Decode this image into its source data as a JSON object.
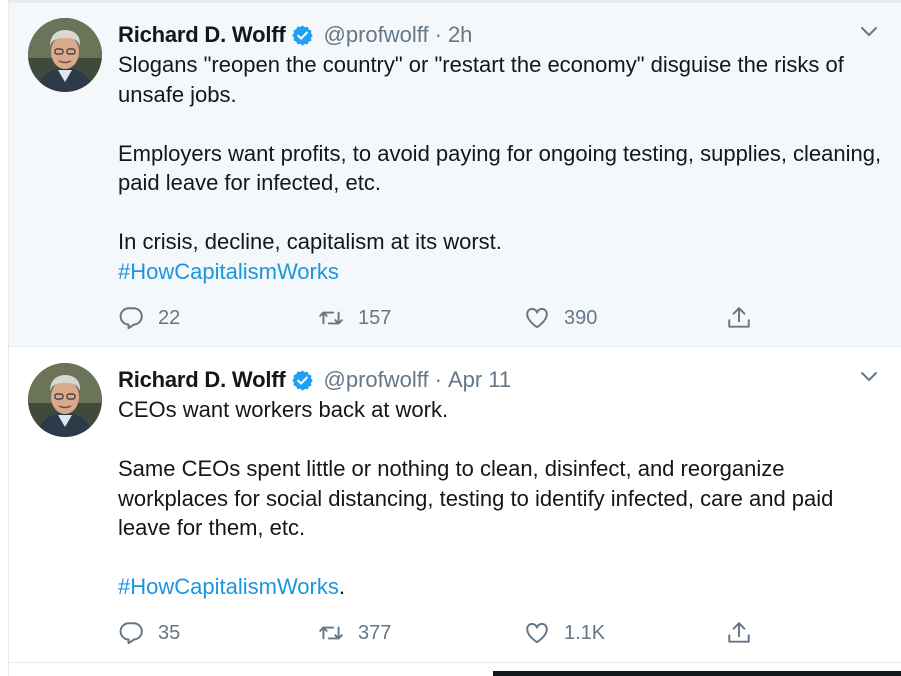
{
  "tweets": [
    {
      "author_name": "Richard D. Wolff",
      "handle": "@profwolff",
      "separator": "·",
      "time": "2h",
      "verified": true,
      "body": [
        "Slogans \"reopen the country\" or \"restart the economy\" disguise the risks of unsafe jobs.",
        "Employers want profits, to avoid paying for ongoing testing, supplies, cleaning, paid leave for infected, etc.",
        "In crisis, decline, capitalism at its worst."
      ],
      "hashtag": "#HowCapitalismWorks",
      "hashtag_suffix": "",
      "replies": "22",
      "retweets": "157",
      "likes": "390"
    },
    {
      "author_name": "Richard D. Wolff",
      "handle": "@profwolff",
      "separator": "·",
      "time": "Apr 11",
      "verified": true,
      "body": [
        "CEOs want workers back at work.",
        "Same CEOs spent little or nothing to clean, disinfect, and reorganize workplaces for social distancing, testing to identify infected, care and paid leave for them, etc."
      ],
      "hashtag": "#HowCapitalismWorks",
      "hashtag_suffix": ".",
      "replies": "35",
      "retweets": "377",
      "likes": "1.1K"
    }
  ],
  "icons": {
    "reply": "reply-icon",
    "retweet": "retweet-icon",
    "like": "heart-icon",
    "share": "share-icon",
    "verified": "verified-badge-icon",
    "more": "chevron-down-icon"
  },
  "colors": {
    "text": "#14171a",
    "secondary": "#657786",
    "link": "#1b95e0",
    "verified": "#1da1f2",
    "highlight_bg": "#f5f8fa",
    "border": "#e6ecf0"
  }
}
